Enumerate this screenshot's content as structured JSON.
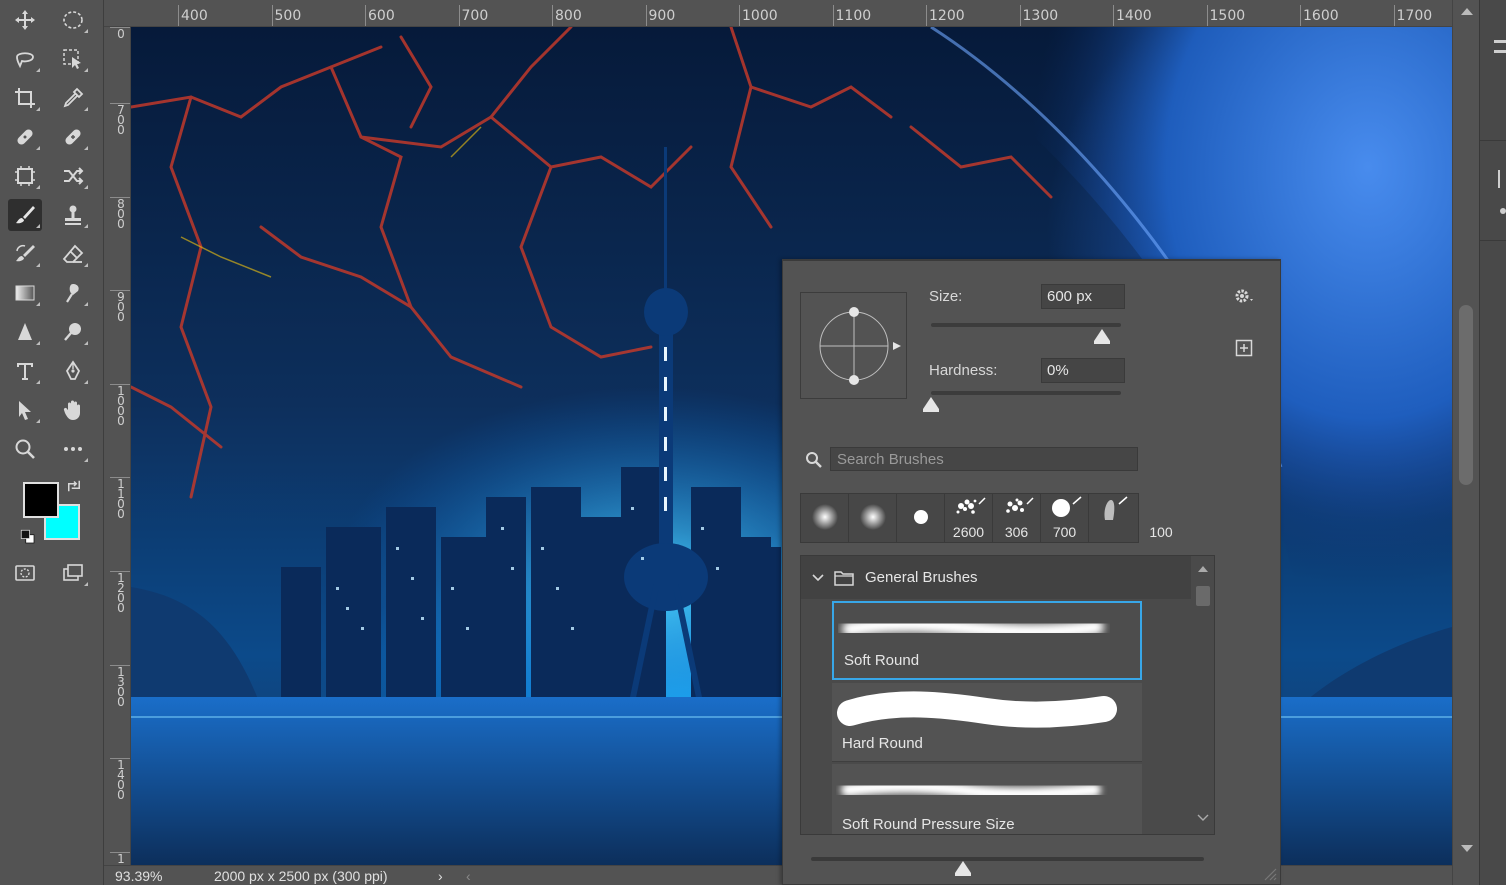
{
  "ruler": {
    "top_labels": [
      "400",
      "500",
      "600",
      "700",
      "800",
      "900",
      "1000",
      "1100",
      "1200",
      "1300",
      "1400",
      "1500",
      "1600",
      "1700"
    ],
    "left_labels": [
      "0",
      "700",
      "800",
      "900",
      "1000",
      "1100",
      "1200",
      "1300",
      "1400",
      "1"
    ]
  },
  "status": {
    "zoom": "93.39%",
    "doc_info": "2000 px x 2500 px (300 ppi)",
    "arrow": "›",
    "scroll_left": "‹"
  },
  "brush_panel": {
    "size_label": "Size:",
    "size_value": "600 px",
    "size_level": 0.9,
    "hardness_label": "Hardness:",
    "hardness_value": "0%",
    "hardness_level": 0.0,
    "search_placeholder": "Search Brushes",
    "recent_brushes": [
      {
        "icon": "soft-round-dot",
        "size": ""
      },
      {
        "icon": "soft-round-dot",
        "size": ""
      },
      {
        "icon": "hard-round-dot",
        "size": ""
      },
      {
        "icon": "splatter-brush",
        "size": "2600"
      },
      {
        "icon": "splatter-brush",
        "size": "306"
      },
      {
        "icon": "round-brush",
        "size": "700"
      },
      {
        "icon": "blob-brush",
        "size": "100"
      }
    ],
    "group_name": "General Brushes",
    "brushes": [
      {
        "name": "Soft Round",
        "selected": true
      },
      {
        "name": "Hard Round",
        "selected": false
      },
      {
        "name": "Soft Round Pressure Size",
        "selected": false
      }
    ]
  },
  "colors": {
    "foreground": "#000000",
    "background": "#00ffff",
    "selection_accent": "#38a7e8"
  }
}
